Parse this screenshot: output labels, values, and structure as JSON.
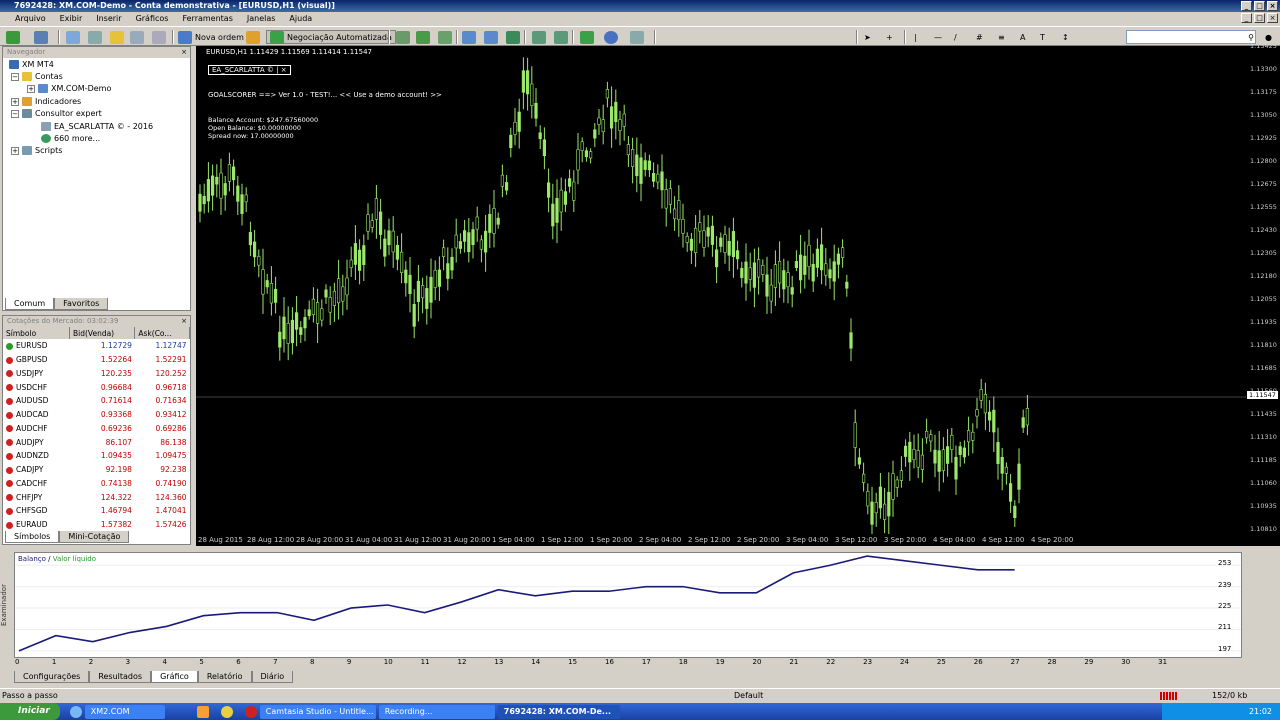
{
  "window": {
    "title": "7692428: XM.COM-Demo - Conta demonstrativa - [EURUSD,H1 (visual)]"
  },
  "menu": [
    "Arquivo",
    "Exibir",
    "Inserir",
    "Gráficos",
    "Ferramentas",
    "Janelas",
    "Ajuda"
  ],
  "toolbar": {
    "new_order": "Nova ordem",
    "auto_trading": "Negociação Automatizada"
  },
  "navigator": {
    "title": "Navegador",
    "items": [
      {
        "label": "XM MT4"
      },
      {
        "label": "Contas"
      },
      {
        "label": "XM.COM-Demo"
      },
      {
        "label": "Indicadores"
      },
      {
        "label": "Consultor expert"
      },
      {
        "label": "EA_SCARLATTA © - 2016"
      },
      {
        "label": "660 more..."
      },
      {
        "label": "Scripts"
      }
    ],
    "tabs": [
      "Comum",
      "Favoritos"
    ]
  },
  "market_watch": {
    "title": "Cotações do Mercado: 03:02:39",
    "columns": [
      "Símbolo",
      "Bid(Venda)",
      "Ask(Co..."
    ],
    "rows": [
      {
        "symbol": "EURUSD",
        "bid": "1.12729",
        "ask": "1.12747"
      },
      {
        "symbol": "GBPUSD",
        "bid": "1.52264",
        "ask": "1.52291"
      },
      {
        "symbol": "USDJPY",
        "bid": "120.235",
        "ask": "120.252"
      },
      {
        "symbol": "USDCHF",
        "bid": "0.96684",
        "ask": "0.96718"
      },
      {
        "symbol": "AUDUSD",
        "bid": "0.71614",
        "ask": "0.71634"
      },
      {
        "symbol": "AUDCAD",
        "bid": "0.93368",
        "ask": "0.93412"
      },
      {
        "symbol": "AUDCHF",
        "bid": "0.69236",
        "ask": "0.69286"
      },
      {
        "symbol": "AUDJPY",
        "bid": "86.107",
        "ask": "86.138"
      },
      {
        "symbol": "AUDNZD",
        "bid": "1.09435",
        "ask": "1.09475"
      },
      {
        "symbol": "CADJPY",
        "bid": "92.198",
        "ask": "92.238"
      },
      {
        "symbol": "CADCHF",
        "bid": "0.74138",
        "ask": "0.74190"
      },
      {
        "symbol": "CHFJPY",
        "bid": "124.322",
        "ask": "124.360"
      },
      {
        "symbol": "CHFSGD",
        "bid": "1.46794",
        "ask": "1.47041"
      },
      {
        "symbol": "EURAUD",
        "bid": "1.57382",
        "ask": "1.57426"
      }
    ],
    "tabs": [
      "Símbolos",
      "Mini-Cotação"
    ]
  },
  "chart": {
    "header": "EURUSD,H1  1.11429 1.11569 1.11414 1.11547",
    "ea_label": "EA_SCARLATTA ©  |  ×",
    "info_line": "GOALSCORER ==> Ver 1.0 -  TEST!...   << Use a demo account! >>",
    "balance": "Balance Account: $247.67560000",
    "open_balance": "Open  Balance:  $0.00000000",
    "spread": "Spread now: 17.00000000",
    "price_labels": [
      "1.13425",
      "1.13300",
      "1.13175",
      "1.13050",
      "1.12925",
      "1.12800",
      "1.12675",
      "1.12555",
      "1.12430",
      "1.12305",
      "1.12180",
      "1.12055",
      "1.11935",
      "1.11810",
      "1.11685",
      "1.11560",
      "1.11435",
      "1.11310",
      "1.11185",
      "1.11060",
      "1.10935",
      "1.10810"
    ],
    "current_price": "1.11547",
    "time_labels": [
      "28 Aug 2015",
      "28 Aug 12:00",
      "28 Aug 20:00",
      "31 Aug 04:00",
      "31 Aug 12:00",
      "31 Aug 20:00",
      "1 Sep 04:00",
      "1 Sep 12:00",
      "1 Sep 20:00",
      "2 Sep 04:00",
      "2 Sep 12:00",
      "2 Sep 20:00",
      "3 Sep 04:00",
      "3 Sep 12:00",
      "3 Sep 20:00",
      "4 Sep 04:00",
      "4 Sep 12:00",
      "4 Sep 20:00"
    ]
  },
  "tester": {
    "side_label": "Examinador",
    "legend_balance": "Balanço",
    "legend_equity": "Valor líquido",
    "tabs": [
      "Configurações",
      "Resultados",
      "Gráfico",
      "Relatório",
      "Diário"
    ],
    "active_tab": "Gráfico"
  },
  "chart_data": {
    "type": "line",
    "x": [
      0,
      1,
      2,
      3,
      4,
      5,
      6,
      7,
      8,
      9,
      10,
      11,
      12,
      13,
      14,
      15,
      16,
      17,
      18,
      19,
      20,
      21,
      22,
      23,
      24,
      25,
      26,
      27
    ],
    "series": [
      {
        "name": "Balanço",
        "values": [
          197,
          207,
          203,
          209,
          213,
          220,
          222,
          222,
          217,
          225,
          227,
          222,
          229,
          237,
          233,
          236,
          236,
          239,
          239,
          235,
          235,
          248,
          253,
          259,
          256,
          253,
          250,
          250
        ]
      }
    ],
    "x_ticks": [
      "0",
      "1",
      "2",
      "3",
      "4",
      "5",
      "6",
      "7",
      "8",
      "9",
      "10",
      "11",
      "12",
      "13",
      "14",
      "15",
      "16",
      "17",
      "18",
      "19",
      "20",
      "21",
      "22",
      "23",
      "24",
      "25",
      "26",
      "27",
      "28",
      "29",
      "30",
      "31"
    ],
    "y_ticks": [
      "253",
      "239",
      "225",
      "211",
      "197"
    ],
    "ylim": [
      193,
      261
    ],
    "xlim": [
      0,
      32
    ],
    "color": "#1a1a7a"
  },
  "status": {
    "left": "Passo a passo",
    "middle": "Default",
    "right": "152/0 kb"
  },
  "taskbar": {
    "start": "Iniciar",
    "tasks": [
      "XM2.COM",
      "Camtasia Studio - Untitle...",
      "Recording...",
      "7692428: XM.COM-De..."
    ],
    "clock": "21:02"
  }
}
